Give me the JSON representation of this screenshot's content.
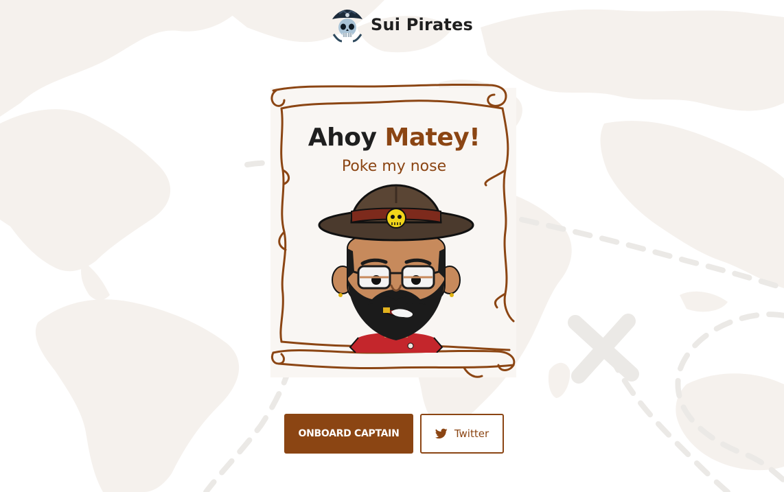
{
  "header": {
    "brand_name": "Sui Pirates",
    "logo_icon": "pirate-skull-logo-icon"
  },
  "card": {
    "title_plain": "Ahoy",
    "title_accent": "Matey!",
    "subtitle": "Poke my nose",
    "avatar_icon": "pirate-captain-avatar"
  },
  "actions": {
    "onboard_label": "ONBOARD CAPTAIN",
    "twitter_label": "Twitter",
    "twitter_icon": "twitter-bird-icon"
  },
  "colors": {
    "accent": "#8b4513",
    "text": "#1f1f1f",
    "map": "#f4f0ec"
  }
}
